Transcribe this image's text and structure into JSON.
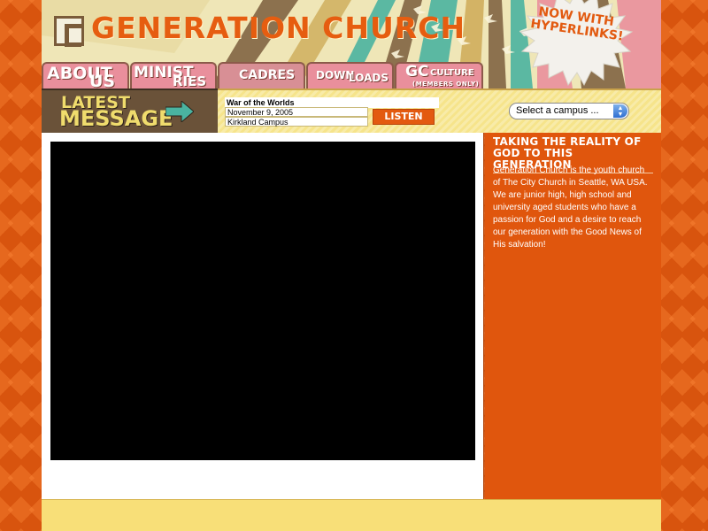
{
  "header": {
    "brand": "GENERATION CHURCH",
    "promo_line1": "NOW WITH",
    "promo_line2": "HYPERLINKS!"
  },
  "nav": {
    "about_1": "ABOUT",
    "about_2": "US",
    "ministries_1": "MINIST",
    "ministries_2": "RIES",
    "cadres": "CADRES",
    "downloads_1": "DOWN",
    "downloads_2": "LOADS",
    "gc_1": "GC",
    "gc_2": "CULTURE",
    "gc_3": "(MEMBERS ONLY)"
  },
  "latest": {
    "line1": "LATEST",
    "line2": "MESSAGE"
  },
  "message": {
    "title": "War of the Worlds",
    "date": "November 9, 2005",
    "campus": "Kirkland Campus",
    "listen_label": "LISTEN"
  },
  "campus_select": {
    "selected": "Select a campus ..."
  },
  "sidebar": {
    "heading": "TAKING THE REALITY OF GOD TO THIS GENERATION",
    "text": "Generation Church is the youth church of The City Church in Seattle, WA USA. We are junior high, high school and university aged students who have a passion for God and a desire to reach our generation with the Good News of His salvation!"
  },
  "colors": {
    "orange": "#e0560d",
    "cream": "#efe6b7",
    "tab_pink": "#e98f9c",
    "brown": "#6a5239",
    "teal": "#4ab3a0"
  }
}
